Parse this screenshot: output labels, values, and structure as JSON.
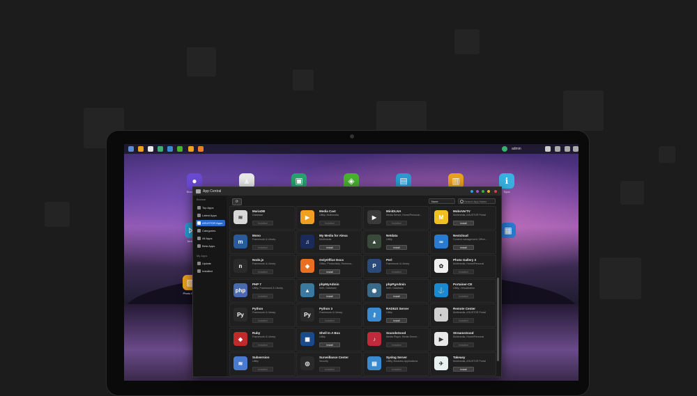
{
  "taskbar": {
    "user": "admin"
  },
  "desktop": {
    "icons": [
      {
        "label": "Storage Man",
        "color": "#6a4ad0",
        "glyph": "●"
      },
      {
        "label": "",
        "color": "#e8e8e8",
        "glyph": "▲"
      },
      {
        "label": "",
        "color": "#2aa070",
        "glyph": "▣"
      },
      {
        "label": "",
        "color": "#4ab030",
        "glyph": "◈"
      },
      {
        "label": "",
        "color": "#2a9ad0",
        "glyph": "▤"
      },
      {
        "label": "",
        "color": "#e8a020",
        "glyph": "▥"
      },
      {
        "label": "Sync",
        "color": "#3ab0e0",
        "glyph": "ℹ"
      },
      {
        "label": "Network",
        "color": "#2a9ad0",
        "glyph": "⋈"
      },
      {
        "label": "Photo Galle",
        "color": "#e8a020",
        "glyph": "▨"
      },
      {
        "label": "",
        "color": "#2a7ad0",
        "glyph": "▦"
      }
    ]
  },
  "window": {
    "title": "App Central"
  },
  "sidebar": {
    "browse_label": "Browse",
    "items": [
      {
        "label": "Top Apps"
      },
      {
        "label": "Latest Apps"
      },
      {
        "label": "ASUSTOR Apps"
      },
      {
        "label": "Categories"
      },
      {
        "label": "All Apps"
      },
      {
        "label": "Beta Apps"
      }
    ],
    "myapps_label": "My Apps",
    "my_items": [
      {
        "label": "Update"
      },
      {
        "label": "Installed"
      }
    ]
  },
  "toolbar": {
    "filter_value": "None",
    "search_placeholder": "Search App Name"
  },
  "apps": [
    {
      "name": "MariaDB",
      "category": "Database",
      "button": "Installed",
      "color": "#d8d8d8",
      "glyph": "≋"
    },
    {
      "name": "Media Cast",
      "category": "Utility, Multimedia",
      "button": "Installed",
      "color": "#f0a020",
      "glyph": "▶"
    },
    {
      "name": "MiniDLNA",
      "category": "Media Server, Home/Personal...",
      "button": "Installed",
      "color": "#3a3a3a",
      "glyph": "▶"
    },
    {
      "name": "MoboVerTV",
      "category": "Multimedia, ASUSTOR Portal",
      "button": "Install",
      "color": "#f0c020",
      "glyph": "M"
    },
    {
      "name": "Mono",
      "category": "Framework & Library",
      "button": "Installed",
      "color": "#2a5a9a",
      "glyph": "m"
    },
    {
      "name": "My Media for Alexa",
      "category": "Multimedia",
      "button": "Install",
      "color": "#1a2a5a",
      "glyph": "♫"
    },
    {
      "name": "Netdata",
      "category": "Utility",
      "button": "Install",
      "color": "#3a4a3a",
      "glyph": "▲"
    },
    {
      "name": "Nextcloud",
      "category": "Content management, Office...",
      "button": "Install",
      "color": "#2a7ad0",
      "glyph": "∞"
    },
    {
      "name": "Node.js",
      "category": "Framework & Library",
      "button": "Installed",
      "color": "#2a2a2a",
      "glyph": "n"
    },
    {
      "name": "OnlyOffice Docs",
      "category": "Office, Productivity, Technica...",
      "button": "Install",
      "color": "#e87020",
      "glyph": "◆"
    },
    {
      "name": "Perl",
      "category": "Framework & Library",
      "button": "Installed",
      "color": "#2a4a7a",
      "glyph": "P"
    },
    {
      "name": "Photo Gallery 3",
      "category": "Multimedia, Home/Personal",
      "button": "Installed",
      "color": "#f0f0f0",
      "glyph": "✿"
    },
    {
      "name": "PHP 7",
      "category": "Utility, Framework & Library",
      "button": "Installed",
      "color": "#4a6ab0",
      "glyph": "php"
    },
    {
      "name": "phpMyAdmin",
      "category": "Web, Database",
      "button": "Install",
      "color": "#3a7aa0",
      "glyph": "▲"
    },
    {
      "name": "phpPgAdmin",
      "category": "Web, Database",
      "button": "Install",
      "color": "#3a6a8a",
      "glyph": "◉"
    },
    {
      "name": "Portainer-CE",
      "category": "Utility, Virtualization",
      "button": "Installed",
      "color": "#1a8ad0",
      "glyph": "⚓"
    },
    {
      "name": "Python",
      "category": "Framework & Library",
      "button": "Installed",
      "color": "#2a2a2a",
      "glyph": "Py"
    },
    {
      "name": "Python 3",
      "category": "Framework & Library",
      "button": "Installed",
      "color": "#2a2a2a",
      "glyph": "Py"
    },
    {
      "name": "RADIUS Server",
      "category": "Utility",
      "button": "Install",
      "color": "#3a8ad0",
      "glyph": "⚷"
    },
    {
      "name": "Remote Center",
      "category": "Multimedia, ASUSTOR Portal",
      "button": "Installed",
      "color": "#d0d0d0",
      "glyph": "◐"
    },
    {
      "name": "Ruby",
      "category": "Framework & Library",
      "button": "Installed",
      "color": "#c02a2a",
      "glyph": "◆"
    },
    {
      "name": "Shell In A Box",
      "category": "Utility",
      "button": "Install",
      "color": "#1a4a8a",
      "glyph": "▦"
    },
    {
      "name": "SoundsGood",
      "category": "Media Player, Media Server...",
      "button": "Installed",
      "color": "#c02a3a",
      "glyph": "♪"
    },
    {
      "name": "StreamsGood",
      "category": "Multimedia, Home/Personal",
      "button": "Installed",
      "color": "#e8e8e8",
      "glyph": "▶"
    },
    {
      "name": "Subversion",
      "category": "Utility",
      "button": "Installed",
      "color": "#4a7ad0",
      "glyph": "≋"
    },
    {
      "name": "Surveillance Center",
      "category": "Security",
      "button": "Installed",
      "color": "#2a2a2a",
      "glyph": "◎"
    },
    {
      "name": "Syslog Server",
      "category": "Utility, Business Applications",
      "button": "Installed",
      "color": "#3a8ad0",
      "glyph": "▤"
    },
    {
      "name": "Takeasy",
      "category": "Multimedia, ASUSTOR Portal",
      "button": "Install",
      "color": "#e8f0f0",
      "glyph": "✈"
    }
  ]
}
